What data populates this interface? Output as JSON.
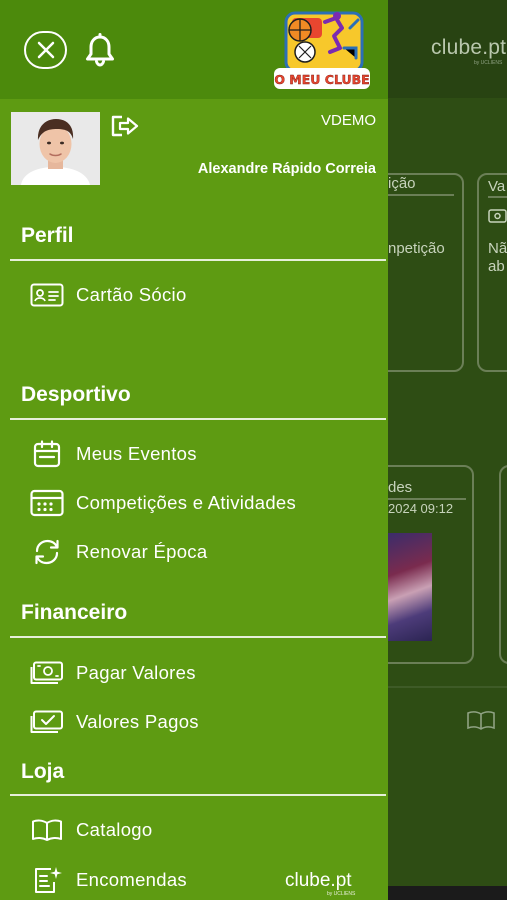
{
  "background": {
    "brand": "clube.pt",
    "brand_sub": "by UCLIENS",
    "card1_title": "ição",
    "card1_text": "npetição",
    "card2_title": "Va",
    "card2_text_1": "Nã",
    "card2_text_2": "ab",
    "card3_title": "des",
    "card3_date": "2024 09:12"
  },
  "drawer": {
    "logo_text": "O MEU CLUBE",
    "club_code": "VDEMO",
    "user_name": "Alexandre Rápido Correia",
    "sections": [
      {
        "title": "Perfil",
        "items": [
          {
            "label": "Cartão Sócio",
            "icon": "id-card-icon"
          }
        ]
      },
      {
        "title": "Desportivo",
        "items": [
          {
            "label": "Meus Eventos",
            "icon": "calendar-icon"
          },
          {
            "label": "Competições e Atividades",
            "icon": "calendar-grid-icon"
          },
          {
            "label": "Renovar Época",
            "icon": "refresh-icon"
          }
        ]
      },
      {
        "title": "Financeiro",
        "items": [
          {
            "label": "Pagar Valores",
            "icon": "banknote-icon"
          },
          {
            "label": "Valores Pagos",
            "icon": "banknote-check-icon"
          }
        ]
      },
      {
        "title": "Loja",
        "items": [
          {
            "label": "Catalogo",
            "icon": "book-icon"
          },
          {
            "label": "Encomendas",
            "icon": "order-list-icon"
          }
        ]
      }
    ],
    "footer_brand": "clube.pt",
    "footer_brand_sub": "by UCLIENS"
  },
  "colors": {
    "drawer_bg": "#5e9b12",
    "drawer_header_bg": "#4c8a0c",
    "background_dim": "#2e4d14",
    "text": "#ffffff"
  }
}
